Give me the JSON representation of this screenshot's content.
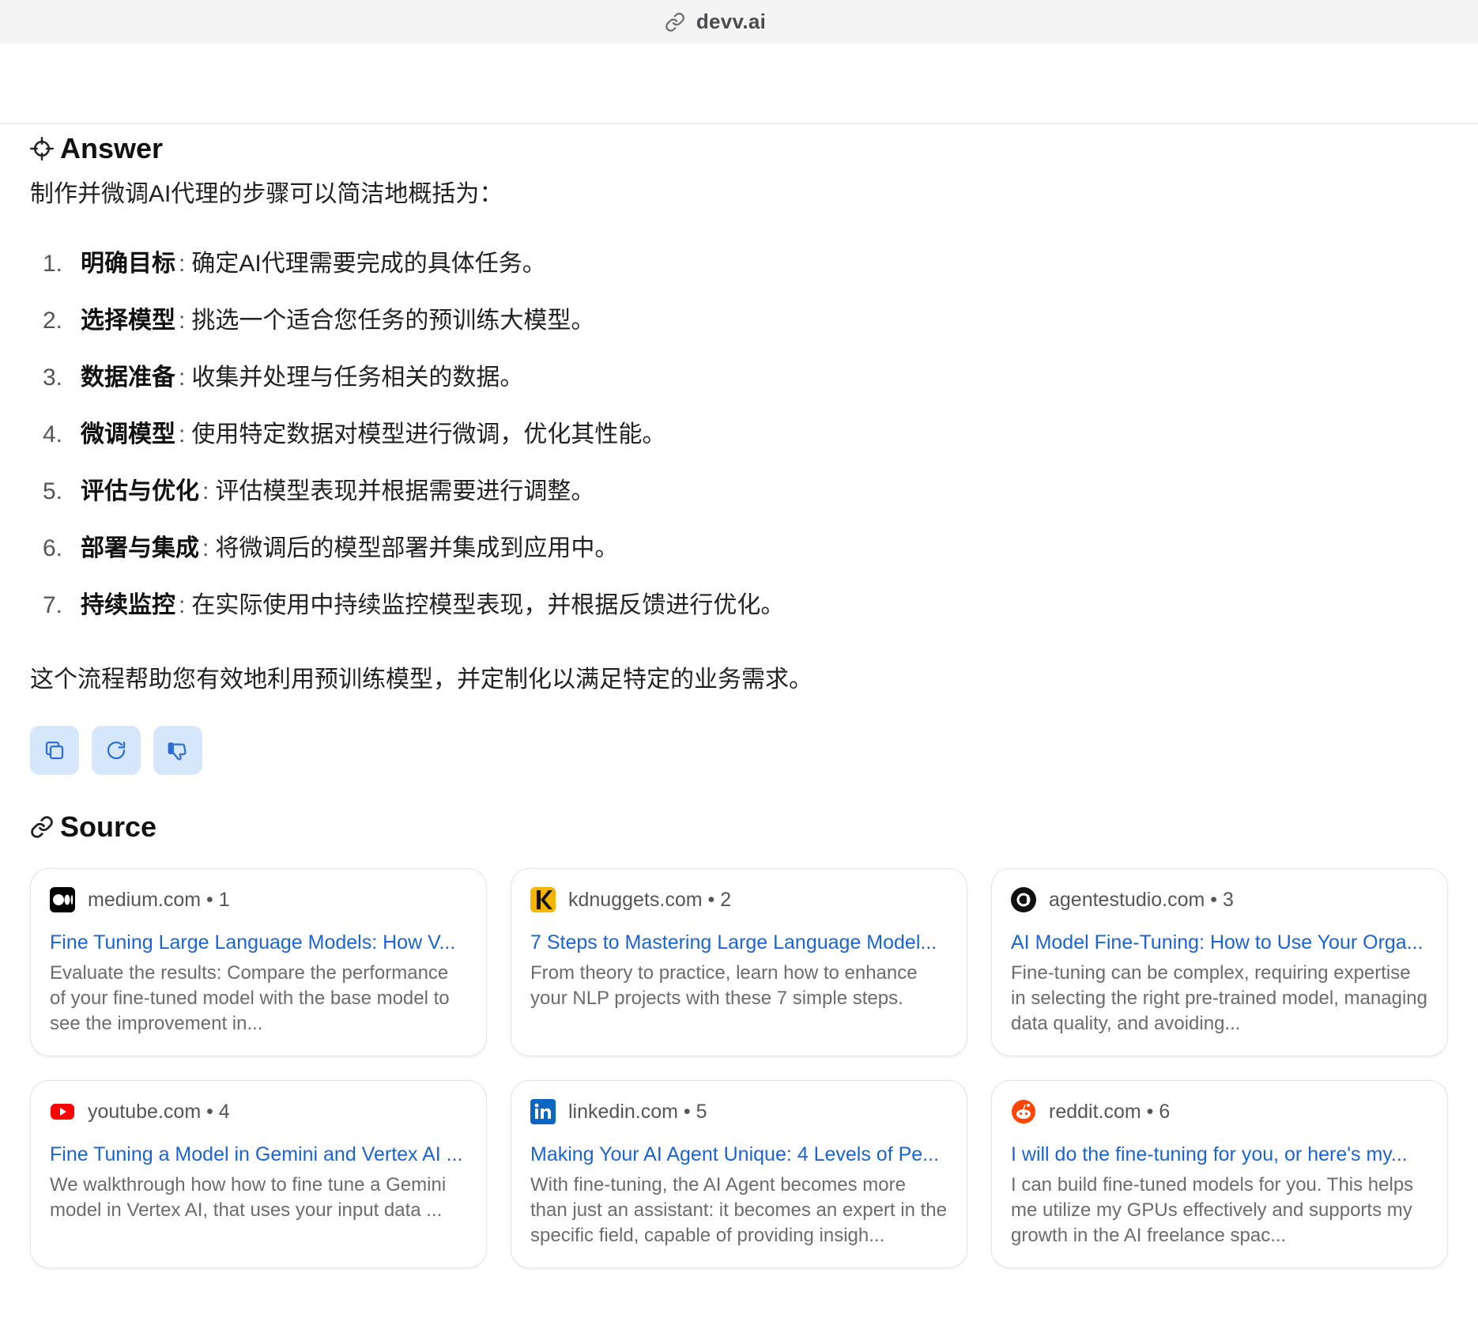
{
  "browser": {
    "url": "devv.ai"
  },
  "answer": {
    "heading": "Answer",
    "intro": "制作并微调AI代理的步骤可以简洁地概括为：",
    "steps": [
      {
        "num": "1.",
        "term": "明确目标",
        "sep": ":",
        "text": "确定AI代理需要完成的具体任务。"
      },
      {
        "num": "2.",
        "term": "选择模型",
        "sep": ":",
        "text": "挑选一个适合您任务的预训练大模型。"
      },
      {
        "num": "3.",
        "term": "数据准备",
        "sep": ":",
        "text": "收集并处理与任务相关的数据。"
      },
      {
        "num": "4.",
        "term": "微调模型",
        "sep": ":",
        "text": "使用特定数据对模型进行微调，优化其性能。"
      },
      {
        "num": "5.",
        "term": "评估与优化",
        "sep": ":",
        "text": "评估模型表现并根据需要进行调整。"
      },
      {
        "num": "6.",
        "term": "部署与集成",
        "sep": ":",
        "text": "将微调后的模型部署并集成到应用中。"
      },
      {
        "num": "7.",
        "term": "持续监控",
        "sep": ":",
        "text": "在实际使用中持续监控模型表现，并根据反馈进行优化。"
      }
    ],
    "conclusion": "这个流程帮助您有效地利用预训练模型，并定制化以满足特定的业务需求。",
    "actions": [
      {
        "name": "copy-button",
        "icon": "copy-icon"
      },
      {
        "name": "regenerate-button",
        "icon": "refresh-icon"
      },
      {
        "name": "dislike-button",
        "icon": "thumbs-down-icon"
      }
    ]
  },
  "sources": {
    "heading": "Source",
    "items": [
      {
        "site": "medium.com",
        "index": "1",
        "favicon": "medium-icon",
        "title": "Fine Tuning Large Language Models: How V...",
        "snippet": "Evaluate the results: Compare the performance of your fine-tuned model with the base model to see the improvement in..."
      },
      {
        "site": "kdnuggets.com",
        "index": "2",
        "favicon": "kdnuggets-icon",
        "title": "7 Steps to Mastering Large Language Model...",
        "snippet": "From theory to practice, learn how to enhance your NLP projects with these 7 simple steps."
      },
      {
        "site": "agentestudio.com",
        "index": "3",
        "favicon": "agentestudio-icon",
        "title": "AI Model Fine-Tuning: How to Use Your Orga...",
        "snippet": "Fine-tuning can be complex, requiring expertise in selecting the right pre-trained model, managing data quality, and avoiding..."
      },
      {
        "site": "youtube.com",
        "index": "4",
        "favicon": "youtube-icon",
        "title": "Fine Tuning a Model in Gemini and Vertex AI ...",
        "snippet": "We walkthrough how how to fine tune a Gemini model in Vertex AI, that uses your input data ..."
      },
      {
        "site": "linkedin.com",
        "index": "5",
        "favicon": "linkedin-icon",
        "title": "Making Your AI Agent Unique: 4 Levels of Pe...",
        "snippet": "With fine-tuning, the AI Agent becomes more than just an assistant: it becomes an expert in the specific field, capable of providing insigh..."
      },
      {
        "site": "reddit.com",
        "index": "6",
        "favicon": "reddit-icon",
        "title": "I will do the fine-tuning for you, or here's my...",
        "snippet": "I can build fine-tuned models for you. This helps me utilize my GPUs effectively and supports my growth in the AI freelance spac..."
      }
    ]
  },
  "colors": {
    "accent": "#1a64d6",
    "action_bg": "#d6e6fb",
    "action_icon": "#2b6fd6"
  }
}
